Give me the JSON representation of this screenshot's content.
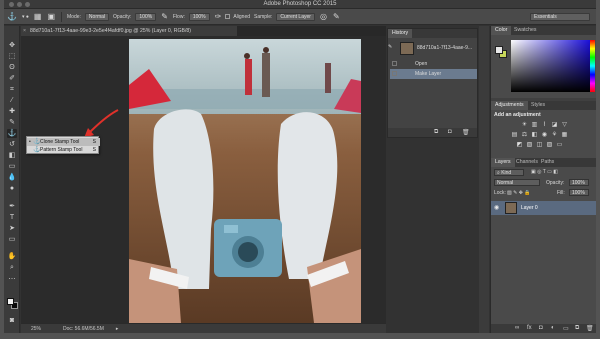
{
  "titlebar": {
    "title": "Adobe Photoshop CC 2015"
  },
  "options_bar": {
    "mode_label": "Mode:",
    "mode_value": "Normal",
    "opacity_label": "Opacity:",
    "opacity_value": "100%",
    "flow_label": "Flow:",
    "flow_value": "100%",
    "aligned_label": "Aligned",
    "sample_label": "Sample:",
    "sample_value": "Current Layer",
    "workspace_value": "Essentials"
  },
  "document_tab": {
    "label": "88d710a1-7f13-4aae-99e3-2e5e4f4afdf0.jpg @ 25% (Layer 0, RGB/8)",
    "close": "×"
  },
  "tool_popup": {
    "items": [
      {
        "label": "Clone Stamp Tool",
        "shortcut": "S",
        "selected": true
      },
      {
        "label": "Pattern Stamp Tool",
        "shortcut": "S",
        "selected": false
      }
    ]
  },
  "status_bar": {
    "zoom": "25%",
    "doc_size": "Doc: 56.6M/56.5M"
  },
  "history_panel": {
    "tab_label": "History",
    "snapshot_name": "88d710a1-7f13-4aae-9...",
    "items": [
      {
        "label": "Open",
        "selected": false
      },
      {
        "label": "Make Layer",
        "selected": true
      }
    ]
  },
  "color_panel": {
    "tab_color": "Color",
    "tab_swatches": "Swatches"
  },
  "adjustments_panel": {
    "tab_adjustments": "Adjustments",
    "tab_styles": "Styles",
    "title": "Add an adjustment"
  },
  "layers_panel": {
    "tab_layers": "Layers",
    "tab_channels": "Channels",
    "tab_paths": "Paths",
    "kind_filter": "Kind",
    "blend_mode": "Normal",
    "opacity_label": "Opacity:",
    "opacity_value": "100%",
    "lock_label": "Lock:",
    "fill_label": "Fill:",
    "fill_value": "100%",
    "layer_name": "Layer 0"
  },
  "colors": {
    "app_bg": "#535353",
    "panel_bg": "#4a4a4a",
    "selection_blue": "#6b7b8f",
    "annotation_red": "#e0312a"
  }
}
